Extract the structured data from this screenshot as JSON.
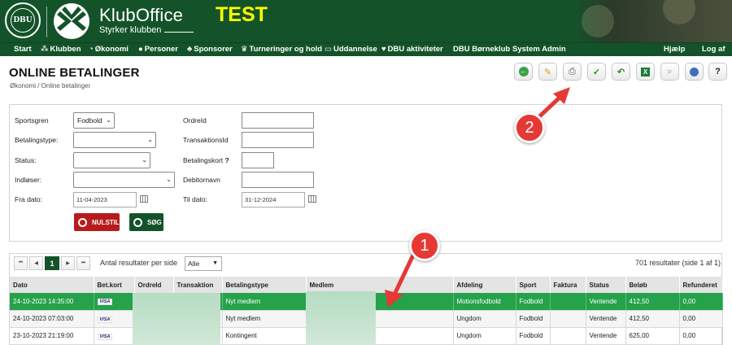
{
  "header": {
    "seal_text": "DBU",
    "app_name": "KlubOffice",
    "tagline": "Styrker klubben",
    "env_label": "TEST"
  },
  "nav": {
    "items": [
      {
        "label": "Start",
        "icon": "home-icon"
      },
      {
        "label": "Klubben",
        "icon": "people-icon"
      },
      {
        "label": "Økonomi",
        "icon": "money-icon"
      },
      {
        "label": "Personer",
        "icon": "person-icon"
      },
      {
        "label": "Sponsorer",
        "icon": "sponsor-icon"
      },
      {
        "label": "Turneringer og hold",
        "icon": "trophy-icon"
      },
      {
        "label": "Uddannelse",
        "icon": "education-icon"
      },
      {
        "label": "DBU aktiviteter",
        "icon": "heart-icon"
      },
      {
        "label": "DBU Børneklub",
        "icon": ""
      },
      {
        "label": "System Admin",
        "icon": ""
      }
    ],
    "right": [
      {
        "label": "Hjælp"
      },
      {
        "label": "Log af"
      }
    ]
  },
  "page": {
    "title": "ONLINE BETALINGER",
    "breadcrumb": "Økonomi / Online betalinger"
  },
  "toolbar": [
    {
      "name": "back-icon",
      "glyph": "←"
    },
    {
      "name": "edit-note-icon",
      "glyph": "✎"
    },
    {
      "name": "print-icon",
      "glyph": "⎙"
    },
    {
      "name": "check-icon",
      "glyph": "✓"
    },
    {
      "name": "undo-icon",
      "glyph": "↶"
    },
    {
      "name": "excel-icon",
      "glyph": "X"
    },
    {
      "name": "magnifier-icon",
      "glyph": "⌕"
    },
    {
      "name": "info-icon",
      "glyph": "●"
    },
    {
      "name": "help-icon",
      "glyph": "?"
    }
  ],
  "filters": {
    "sportsgren_label": "Sportsgren",
    "sportsgren_value": "Fodbold",
    "betalingstype_label": "Betalingstype:",
    "status_label": "Status:",
    "indloser_label": "Indløser:",
    "fradato_label": "Fra dato:",
    "fradato_value": "11-04-2023",
    "ordreid_label": "OrdreId",
    "transaktionsid_label": "TransaktionsId",
    "betalingskort_label": "Betalingskort",
    "betalingskort_help": "?",
    "debitornavn_label": "Debitornavn",
    "tildato_label": "Til dato:",
    "tildato_value": "31-12-2024",
    "reset_label": "NULSTIL",
    "search_label": "SØG"
  },
  "results": {
    "pager": {
      "first": "⏮",
      "prev": "◀",
      "current": "1",
      "next": "▶",
      "last": "⏭"
    },
    "per_page_label": "Antal resultater per side",
    "per_page_value": "Alle",
    "count_text": "701 resultater (side 1 af 1)",
    "columns": [
      "Dato",
      "Bet.kort",
      "OrdreId",
      "Transaktion",
      "Betalingstype",
      "Medlem",
      "Afdeling",
      "Sport",
      "Faktura",
      "Status",
      "Beløb",
      "Refunderet"
    ],
    "rows": [
      {
        "dato": "24-10-2023 14:35:00",
        "kort": "VISA",
        "type": "Nyt medlem",
        "afdeling": "Motionsfodbold",
        "sport": "Fodbold",
        "status": "Ventende",
        "belob": "412,50",
        "refunderet": "0,00"
      },
      {
        "dato": "24-10-2023 07:03:00",
        "kort": "VISA",
        "type": "Nyt medlem",
        "afdeling": "Ungdom",
        "sport": "Fodbold",
        "status": "Ventende",
        "belob": "412,50",
        "refunderet": "0,00"
      },
      {
        "dato": "23-10-2023 21:19:00",
        "kort": "VISA",
        "type": "Kontingent",
        "afdeling": "Ungdom",
        "sport": "Fodbold",
        "status": "Ventende",
        "belob": "625,00",
        "refunderet": "0,00"
      }
    ]
  },
  "callouts": [
    {
      "number": "1"
    },
    {
      "number": "2"
    }
  ],
  "colors": {
    "brand": "#14532a",
    "selected_row": "#25a24b",
    "env": "#ffff00",
    "callout": "#e53935"
  }
}
